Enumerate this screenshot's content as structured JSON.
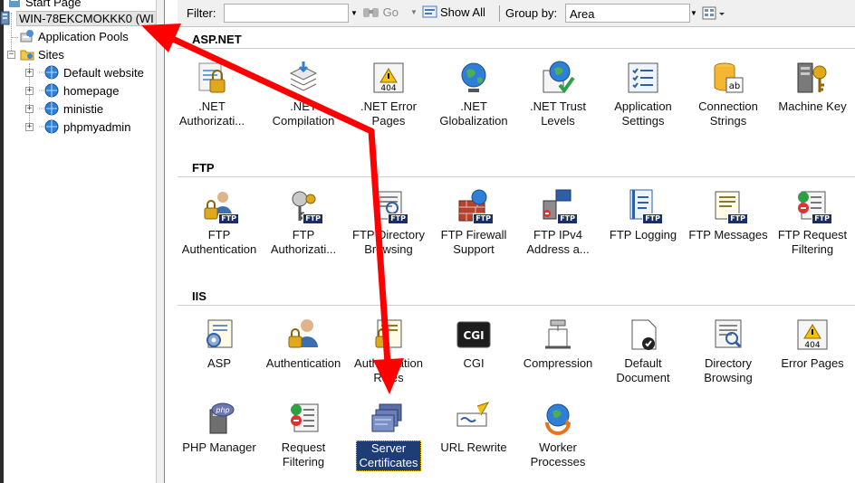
{
  "tree": {
    "items": [
      {
        "label": "Start Page",
        "icon": "start-page-icon"
      },
      {
        "label": "WIN-78EKCMOKKK0 (WI",
        "icon": "server-icon"
      },
      {
        "label": "Application Pools",
        "icon": "app-pools-icon"
      },
      {
        "label": "Sites",
        "icon": "sites-folder-icon"
      },
      {
        "label": "Default website",
        "icon": "globe-icon"
      },
      {
        "label": "homepage",
        "icon": "globe-icon"
      },
      {
        "label": "ministie",
        "icon": "globe-icon"
      },
      {
        "label": "phpmyadmin",
        "icon": "globe-icon"
      }
    ]
  },
  "filterbar": {
    "filter_label": "Filter:",
    "filter_value": "",
    "go_label": "Go",
    "show_all_label": "Show All",
    "group_by_label": "Group by:",
    "group_by_value": "Area"
  },
  "sections": [
    {
      "title": "ASP.NET",
      "features": [
        {
          "line1": ".NET",
          "line2": "Authorizati...",
          "icon": "net-authorization-icon"
        },
        {
          "line1": ".NET",
          "line2": "Compilation",
          "icon": "net-compilation-icon"
        },
        {
          "line1": ".NET Error",
          "line2": "Pages",
          "icon": "net-error-pages-icon"
        },
        {
          "line1": ".NET",
          "line2": "Globalization",
          "icon": "net-globalization-icon"
        },
        {
          "line1": ".NET Trust",
          "line2": "Levels",
          "icon": "net-trust-levels-icon"
        },
        {
          "line1": "Application",
          "line2": "Settings",
          "icon": "application-settings-icon"
        },
        {
          "line1": "Connection",
          "line2": "Strings",
          "icon": "connection-strings-icon"
        },
        {
          "line1": "Machine Key",
          "line2": "",
          "icon": "machine-key-icon"
        }
      ]
    },
    {
      "title": "FTP",
      "features": [
        {
          "line1": "FTP",
          "line2": "Authentication",
          "icon": "ftp-authentication-icon"
        },
        {
          "line1": "FTP",
          "line2": "Authorizati...",
          "icon": "ftp-authorization-icon"
        },
        {
          "line1": "FTP Directory",
          "line2": "Browsing",
          "icon": "ftp-directory-browsing-icon"
        },
        {
          "line1": "FTP Firewall",
          "line2": "Support",
          "icon": "ftp-firewall-icon"
        },
        {
          "line1": "FTP IPv4",
          "line2": "Address a...",
          "icon": "ftp-ipv4-icon"
        },
        {
          "line1": "FTP Logging",
          "line2": "",
          "icon": "ftp-logging-icon"
        },
        {
          "line1": "FTP Messages",
          "line2": "",
          "icon": "ftp-messages-icon"
        },
        {
          "line1": "FTP Request",
          "line2": "Filtering",
          "icon": "ftp-request-filtering-icon"
        }
      ]
    },
    {
      "title": "IIS",
      "features": [
        {
          "line1": "ASP",
          "line2": "",
          "icon": "asp-icon"
        },
        {
          "line1": "Authentication",
          "line2": "",
          "icon": "authentication-icon"
        },
        {
          "line1": "Authorization",
          "line2": "Rules",
          "icon": "authorization-rules-icon"
        },
        {
          "line1": "CGI",
          "line2": "",
          "icon": "cgi-icon"
        },
        {
          "line1": "Compression",
          "line2": "",
          "icon": "compression-icon"
        },
        {
          "line1": "Default",
          "line2": "Document",
          "icon": "default-document-icon"
        },
        {
          "line1": "Directory",
          "line2": "Browsing",
          "icon": "directory-browsing-icon"
        },
        {
          "line1": "Error Pages",
          "line2": "",
          "icon": "error-pages-icon"
        },
        {
          "line1": "PHP Manager",
          "line2": "",
          "icon": "php-manager-icon"
        },
        {
          "line1": "Request",
          "line2": "Filtering",
          "icon": "request-filtering-icon"
        },
        {
          "line1": "Server",
          "line2": "Certificates",
          "icon": "server-certificates-icon",
          "selected": true
        },
        {
          "line1": "URL Rewrite",
          "line2": "",
          "icon": "url-rewrite-icon"
        },
        {
          "line1": "Worker",
          "line2": "Processes",
          "icon": "worker-processes-icon"
        }
      ]
    }
  ],
  "ftp_badge": "FTP",
  "cgi_badge": "CGI",
  "error_badge": "404",
  "php_badge": "php",
  "colors": {
    "annotation_arrow": "#ff0000",
    "selection": "#1e3c76",
    "ftp_badge": "#1a2d66"
  }
}
